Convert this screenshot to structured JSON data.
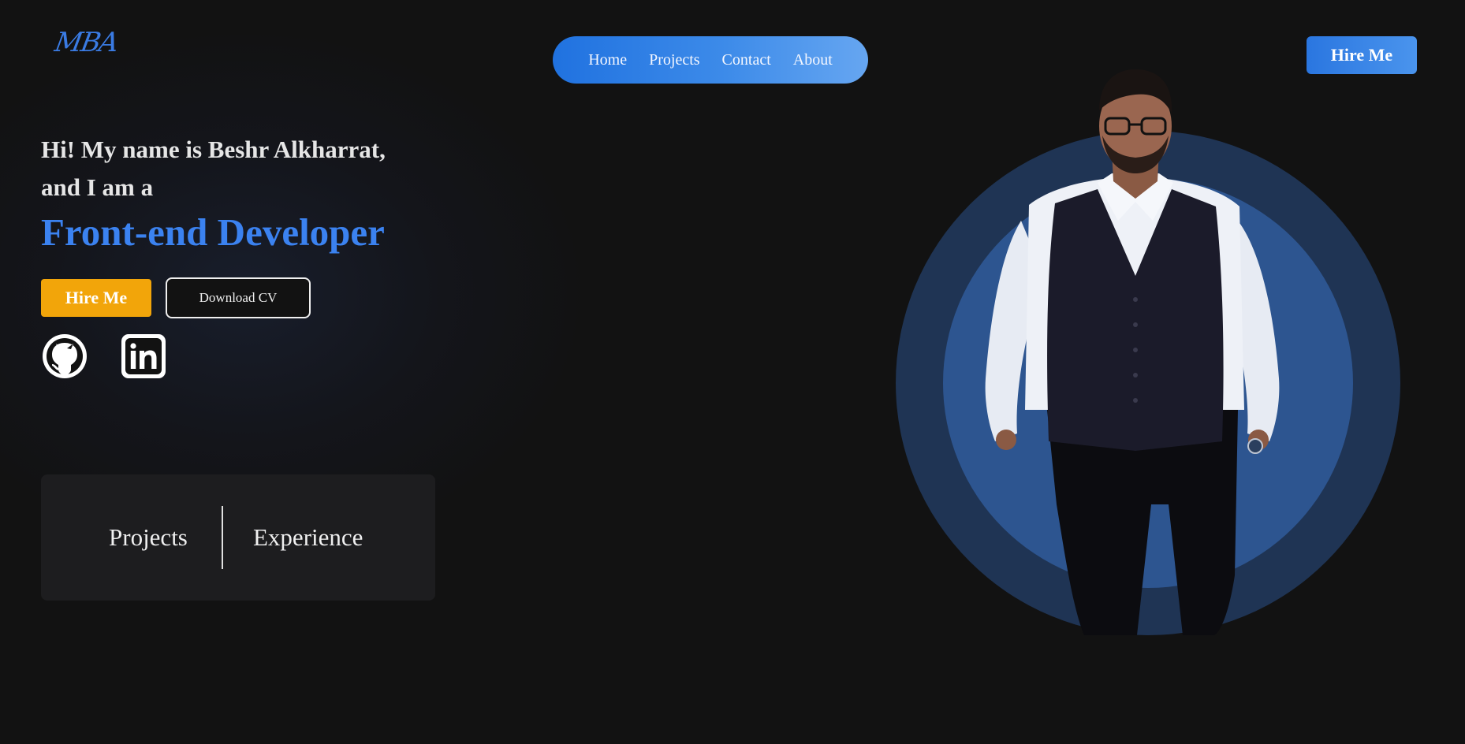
{
  "header": {
    "logo": "MBA",
    "nav": [
      "Home",
      "Projects",
      "Contact",
      "About"
    ],
    "hire_label": "Hire Me"
  },
  "hero": {
    "intro_line1": "Hi! My name is Beshr Alkharrat,",
    "intro_line2": "and I am a",
    "role": "Front-end Developer",
    "hire_label": "Hire Me",
    "download_label": "Download CV",
    "social": [
      "github-icon",
      "linkedin-icon"
    ]
  },
  "stats": {
    "projects_label": "Projects",
    "experience_label": "Experience"
  },
  "colors": {
    "background": "#121212",
    "accent_blue": "#3b82f0",
    "accent_orange": "#f2a50a",
    "circle_outer": "#1f3454",
    "circle_inner": "#2d5590"
  }
}
